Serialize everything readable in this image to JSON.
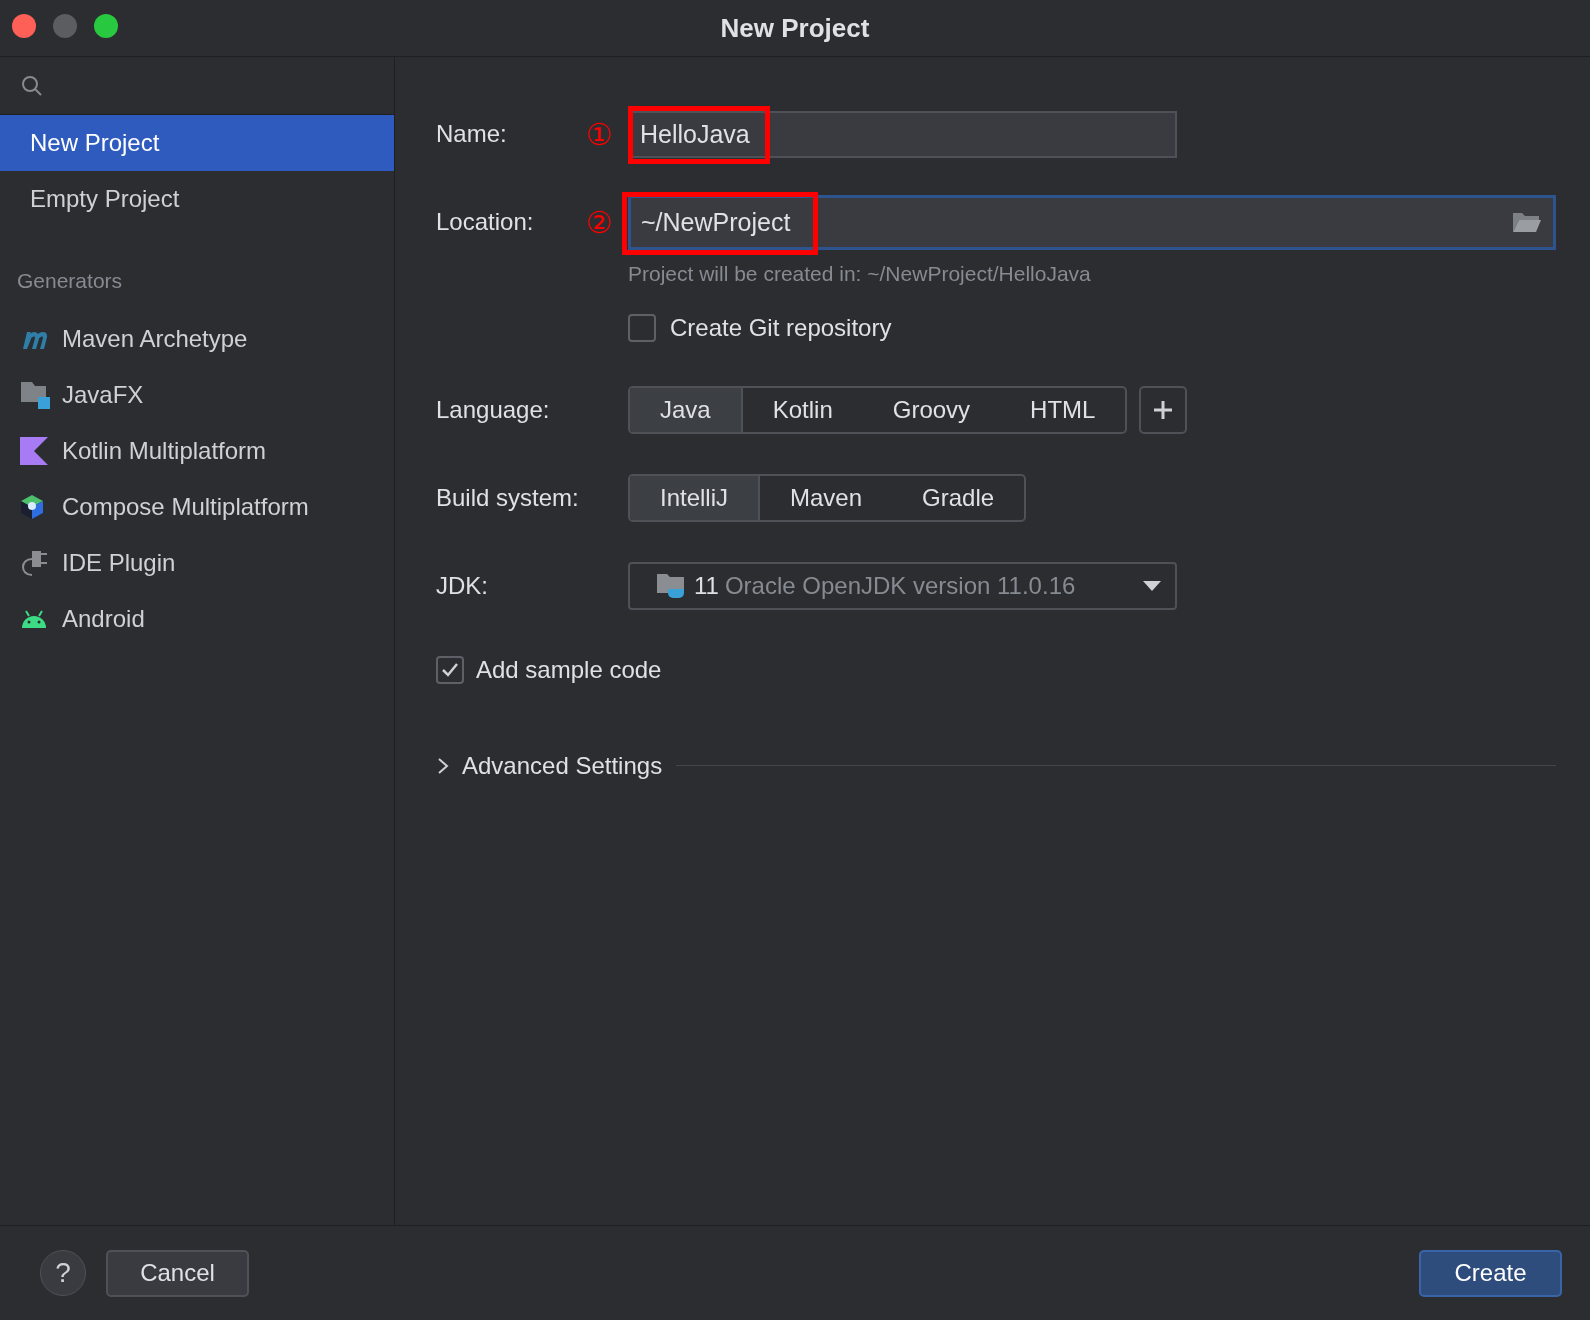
{
  "window": {
    "title": "New Project"
  },
  "sidebar": {
    "items": [
      {
        "label": "New Project",
        "selected": true
      },
      {
        "label": "Empty Project",
        "selected": false
      }
    ],
    "generators_heading": "Generators",
    "generators": [
      {
        "label": "Maven Archetype",
        "kind": "maven"
      },
      {
        "label": "JavaFX",
        "kind": "javafx"
      },
      {
        "label": "Kotlin Multiplatform",
        "kind": "kotlin"
      },
      {
        "label": "Compose Multiplatform",
        "kind": "compose"
      },
      {
        "label": "IDE Plugin",
        "kind": "plugin"
      },
      {
        "label": "Android",
        "kind": "android"
      }
    ]
  },
  "form": {
    "name": {
      "label": "Name:",
      "value": "HelloJava",
      "annotation": "①"
    },
    "location": {
      "label": "Location:",
      "value": "~/NewProject",
      "annotation": "②"
    },
    "location_hint": "Project will be created in: ~/NewProject/HelloJava",
    "git": {
      "label": "Create Git repository",
      "checked": false
    },
    "language": {
      "label": "Language:",
      "options": [
        {
          "label": "Java",
          "selected": true
        },
        {
          "label": "Kotlin",
          "selected": false
        },
        {
          "label": "Groovy",
          "selected": false
        },
        {
          "label": "HTML",
          "selected": false
        }
      ]
    },
    "build_system": {
      "label": "Build system:",
      "options": [
        {
          "label": "IntelliJ",
          "selected": true
        },
        {
          "label": "Maven",
          "selected": false
        },
        {
          "label": "Gradle",
          "selected": false
        }
      ]
    },
    "jdk": {
      "label": "JDK:",
      "version": "11",
      "description": "Oracle OpenJDK version 11.0.16"
    },
    "sample_code": {
      "label": "Add sample code",
      "checked": true
    },
    "advanced": {
      "label": "Advanced Settings",
      "expanded": false
    }
  },
  "footer": {
    "help": "?",
    "cancel": "Cancel",
    "create": "Create"
  }
}
